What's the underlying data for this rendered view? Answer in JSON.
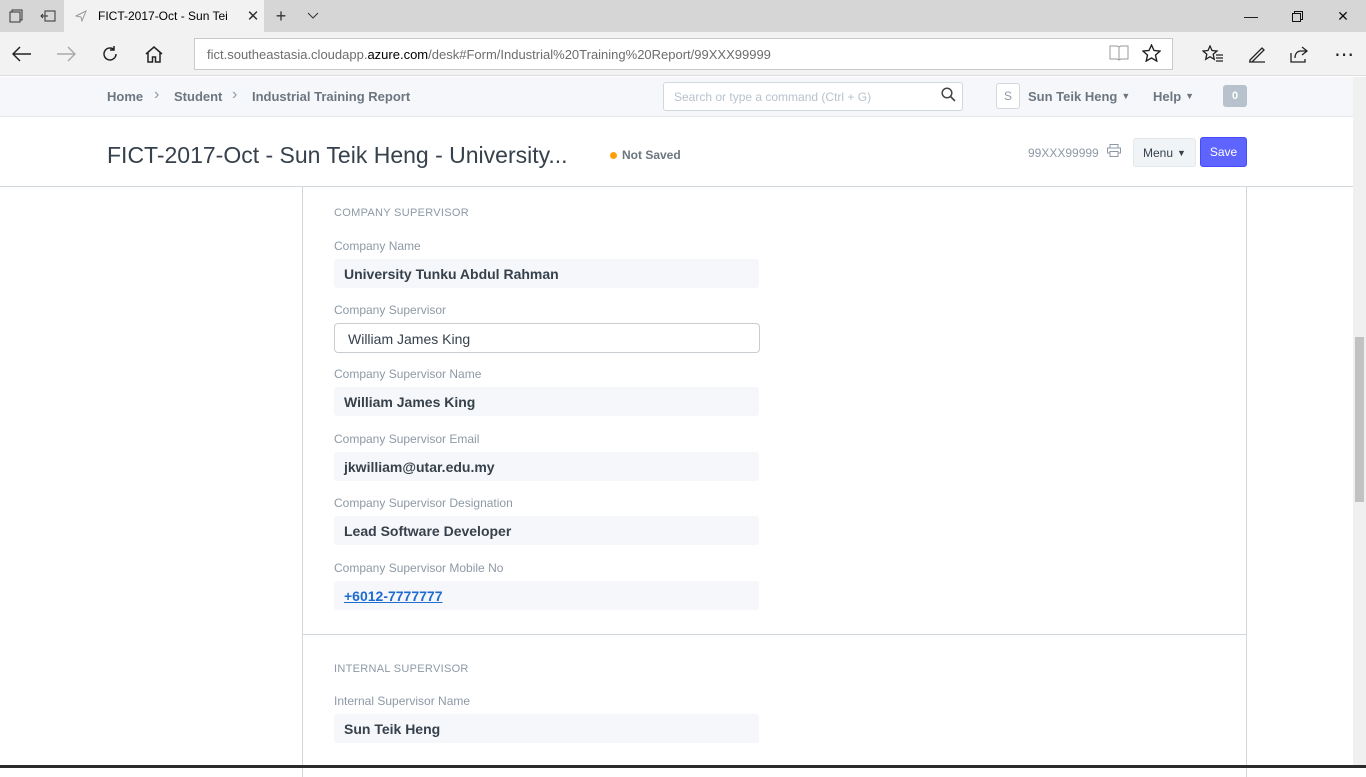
{
  "browser": {
    "tab_title": "FICT-2017-Oct - Sun Tei",
    "url_prefix": "fict.southeastasia.cloudapp.",
    "url_host": "azure.com",
    "url_path": "/desk#Form/Industrial%20Training%20Report/99XXX99999"
  },
  "navbar": {
    "breadcrumbs": [
      "Home",
      "Student",
      "Industrial Training Report"
    ],
    "search_placeholder": "Search or type a command (Ctrl + G)",
    "avatar_letter": "S",
    "user_name": "Sun Teik Heng",
    "help_label": "Help",
    "notification_count": "0"
  },
  "page_head": {
    "title": "FICT-2017-Oct - Sun Teik Heng - University...",
    "status": "Not Saved",
    "doc_name": "99XXX99999",
    "menu_label": "Menu",
    "save_label": "Save"
  },
  "form": {
    "company_section": {
      "heading": "COMPANY SUPERVISOR",
      "company_name_label": "Company Name",
      "company_name": "University Tunku Abdul Rahman",
      "company_supervisor_label": "Company Supervisor",
      "company_supervisor": "William James King",
      "supervisor_name_label": "Company Supervisor Name",
      "supervisor_name": "William James King",
      "supervisor_email_label": "Company Supervisor Email",
      "supervisor_email": "jkwilliam@utar.edu.my",
      "supervisor_designation_label": "Company Supervisor Designation",
      "supervisor_designation": "Lead Software Developer",
      "supervisor_mobile_label": "Company Supervisor Mobile No",
      "supervisor_mobile": "+6012-7777777"
    },
    "internal_section": {
      "heading": "INTERNAL SUPERVISOR",
      "internal_name_label": "Internal Supervisor Name",
      "internal_name": "Sun Teik Heng"
    }
  },
  "colors": {
    "primary_button": "#5e64ff",
    "status_dot": "#ffa00a",
    "link": "#1f6bd0"
  }
}
